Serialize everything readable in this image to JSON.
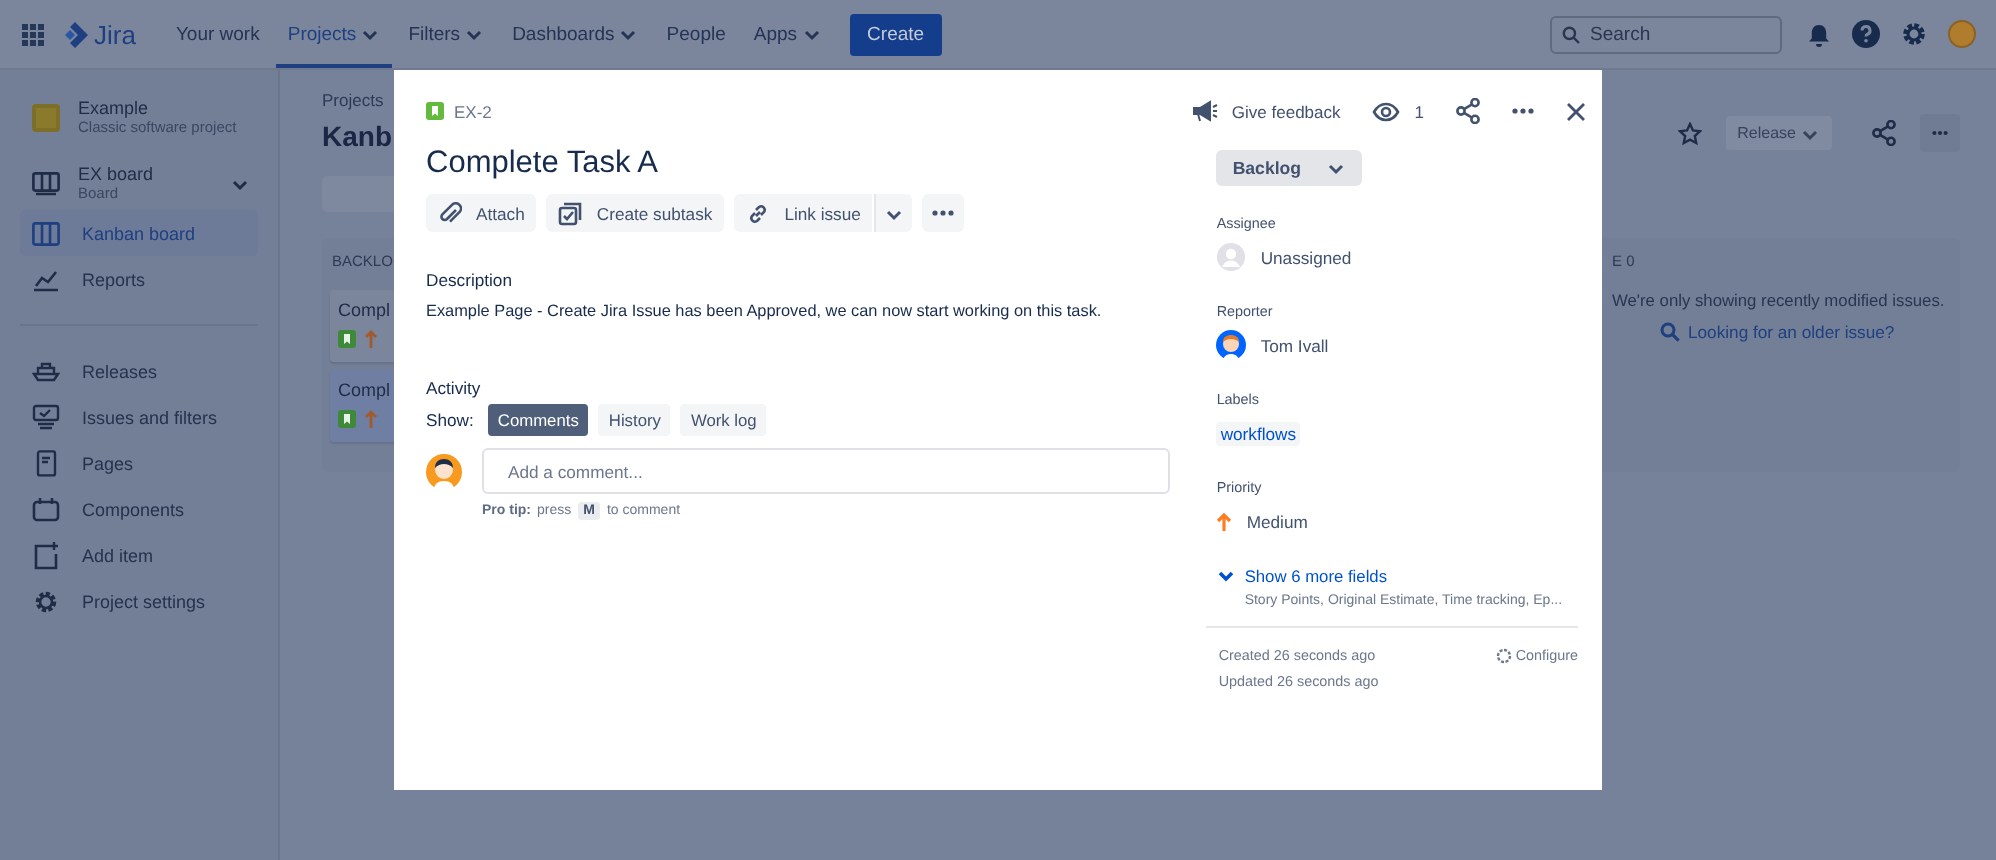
{
  "top_nav": {
    "logo": "Jira",
    "items": [
      {
        "label": "Your work",
        "dropdown": false,
        "selected": false
      },
      {
        "label": "Projects",
        "dropdown": true,
        "selected": true
      },
      {
        "label": "Filters",
        "dropdown": true,
        "selected": false
      },
      {
        "label": "Dashboards",
        "dropdown": true,
        "selected": false
      },
      {
        "label": "People",
        "dropdown": false,
        "selected": false
      },
      {
        "label": "Apps",
        "dropdown": true,
        "selected": false
      }
    ],
    "create_button": "Create",
    "search": {
      "placeholder": "Search"
    }
  },
  "sidebar": {
    "project": {
      "name": "Example",
      "type": "Classic software project"
    },
    "board": {
      "name": "EX board",
      "subtitle": "Board"
    },
    "items": [
      {
        "label": "Kanban board",
        "selected": true
      },
      {
        "label": "Reports",
        "selected": false
      }
    ],
    "more_items": [
      "Releases",
      "Issues and filters",
      "Pages",
      "Components",
      "Add item",
      "Project settings"
    ]
  },
  "board": {
    "breadcrumb": "Projects",
    "title": "Kanb",
    "release_button": {
      "label": "Release",
      "disabled": true
    },
    "backlog_column": {
      "title": "BACKLO",
      "cards": [
        {
          "title": "Compl",
          "selected": false
        },
        {
          "title": "Compl",
          "selected": true
        }
      ]
    },
    "right_column": {
      "title": "E 0",
      "message": "We're only showing recently modified issues.",
      "link": "Looking for an older issue?"
    }
  },
  "issue": {
    "key": "EX-2",
    "feedback": "Give feedback",
    "watchers": "1",
    "title": "Complete Task A",
    "actions": [
      "Attach",
      "Create subtask",
      "Link issue"
    ],
    "description_label": "Description",
    "description": "Example Page - Create Jira Issue has been Approved, we can now start working on this task.",
    "activity_label": "Activity",
    "show_label": "Show:",
    "activity_tabs": [
      {
        "label": "Comments",
        "selected": true
      },
      {
        "label": "History",
        "selected": false
      },
      {
        "label": "Work log",
        "selected": false
      }
    ],
    "comment": {
      "placeholder": "Add a comment..."
    },
    "pro_tip": {
      "lead": "Pro tip:",
      "before": "press",
      "key": "M",
      "after": "to comment"
    },
    "status": "Backlog",
    "fields": [
      {
        "label": "Assignee",
        "kind": "person",
        "value": "Unassigned"
      },
      {
        "label": "Reporter",
        "kind": "person-photo",
        "value": "Tom Ivall"
      },
      {
        "label": "Labels",
        "kind": "tag",
        "value": "workflows"
      },
      {
        "label": "Priority",
        "kind": "priority",
        "value": "Medium"
      }
    ],
    "more_fields": {
      "label": "Show 6 more fields",
      "summary": "Story Points, Original Estimate, Time tracking, Ep..."
    },
    "created": "Created 26 seconds ago",
    "updated": "Updated 26 seconds ago",
    "configure": "Configure"
  }
}
